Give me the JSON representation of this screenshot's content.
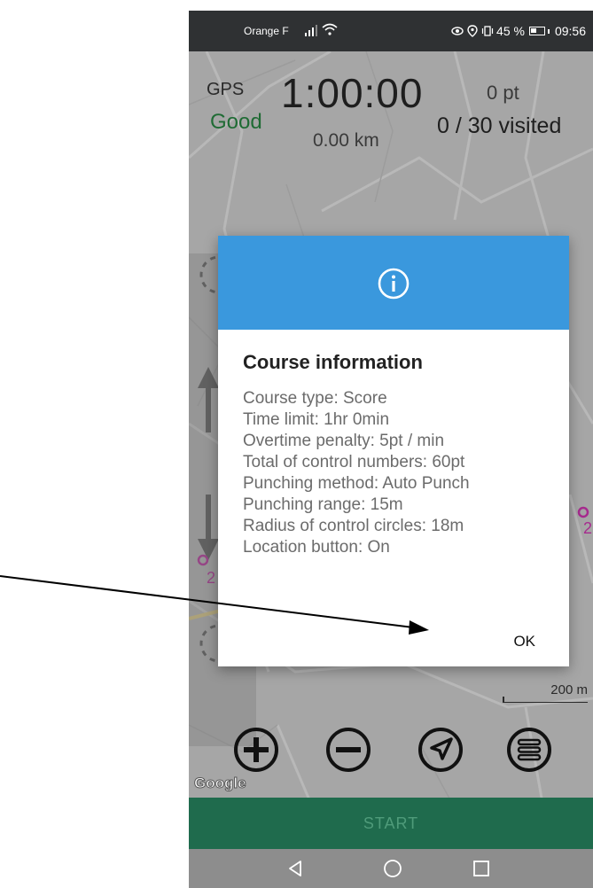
{
  "status_bar": {
    "carrier": "Orange F",
    "battery": "45 %",
    "time": "09:56"
  },
  "hud": {
    "gps_label": "GPS",
    "gps_status": "Good",
    "timer": "1:00:00",
    "distance": "0.00 km",
    "points": "0 pt",
    "visited": "0 / 30 visited"
  },
  "map": {
    "scale_label": "200 m",
    "attribution": "Google"
  },
  "controls": {
    "zoom_in": "plus-circle-icon",
    "zoom_out": "minus-circle-icon",
    "locate": "navigation-icon",
    "menu": "menu-icon"
  },
  "start_button": "START",
  "dialog": {
    "title": "Course information",
    "lines": [
      "Course type: Score",
      "Time limit: 1hr 0min",
      "Overtime penalty: 5pt / min",
      "Total of control numbers: 60pt",
      "Punching method: Auto Punch",
      "Punching range: 15m",
      "Radius of control circles: 18m",
      "Location button: On"
    ],
    "ok_label": "OK"
  },
  "colors": {
    "dialog_header": "#3a98dd",
    "start_bar": "#1f6b4d",
    "gps_good": "#1f6b34"
  }
}
